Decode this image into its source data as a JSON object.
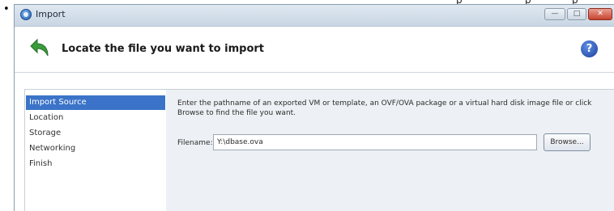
{
  "page": {
    "bullet": "•",
    "top_fragments": [
      "p",
      "p",
      "p"
    ]
  },
  "window": {
    "title": "Import",
    "controls": {
      "minimize": "—",
      "maximize": "□",
      "close": "✕"
    }
  },
  "header": {
    "title": "Locate the file you want to import",
    "help_symbol": "?"
  },
  "nav": {
    "items": [
      {
        "label": "Import Source",
        "selected": true
      },
      {
        "label": "Location",
        "selected": false
      },
      {
        "label": "Storage",
        "selected": false
      },
      {
        "label": "Networking",
        "selected": false
      },
      {
        "label": "Finish",
        "selected": false
      }
    ]
  },
  "main": {
    "description": "Enter the pathname of an exported VM or template, an OVF/OVA package or a virtual hard disk image file or click Browse to find the file you want.",
    "filename_label": "Filename:",
    "filename_value": "Y:\\dbase.ova",
    "browse_label": "Browse..."
  },
  "colors": {
    "selection": "#3b73c8",
    "titlebar": "#c9d6e3",
    "arrow": "#3a9b3a",
    "close_button": "#c7422f"
  },
  "icons": {
    "app": "app-icon",
    "back": "back-arrow-icon",
    "help": "help-icon"
  }
}
